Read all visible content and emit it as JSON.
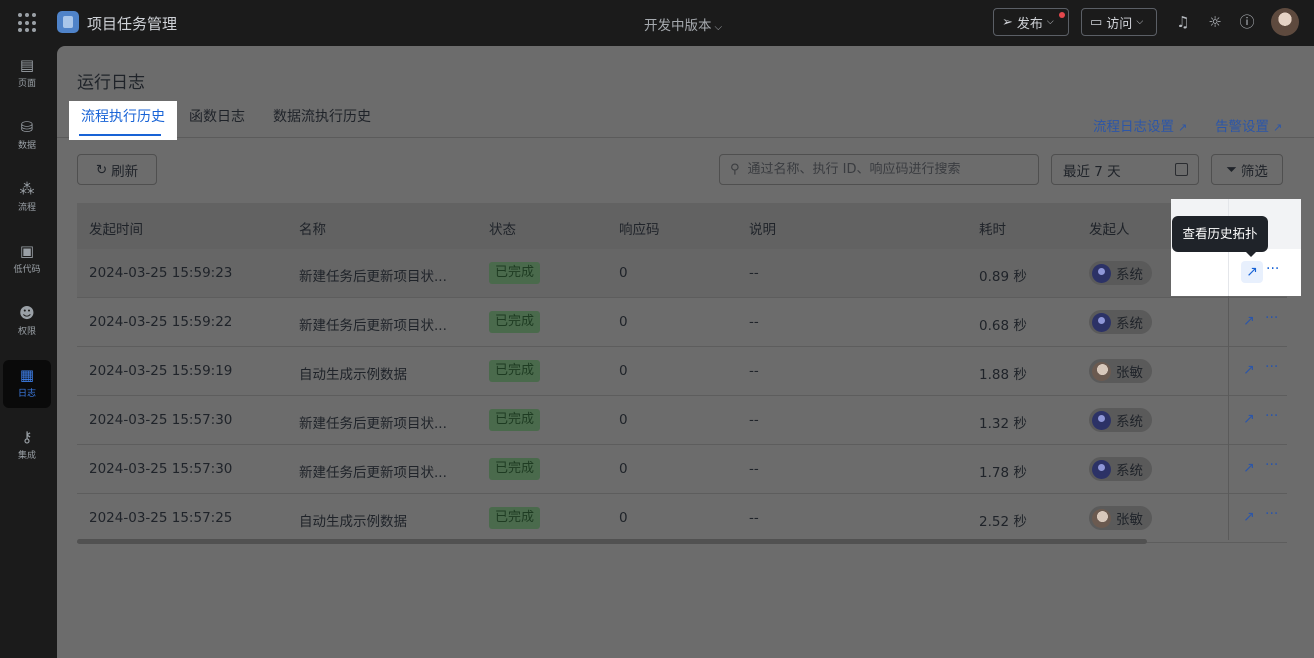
{
  "app": {
    "name": "项目任务管理",
    "version": "开发中版本"
  },
  "topbar": {
    "publish_label": "发布",
    "visit_label": "访问"
  },
  "sidebar": {
    "items": [
      {
        "label": "页面",
        "icon": "page-icon"
      },
      {
        "label": "数据",
        "icon": "database-icon"
      },
      {
        "label": "流程",
        "icon": "flow-icon"
      },
      {
        "label": "低代码",
        "icon": "code-icon"
      },
      {
        "label": "权限",
        "icon": "users-icon"
      },
      {
        "label": "日志",
        "icon": "log-icon",
        "active": true
      },
      {
        "label": "集成",
        "icon": "key-icon"
      }
    ]
  },
  "page": {
    "title": "运行日志",
    "tabs": [
      "流程执行历史",
      "函数日志",
      "数据流执行历史"
    ],
    "links": {
      "flow_log_settings": "流程日志设置",
      "alert_settings": "告警设置"
    }
  },
  "toolbar": {
    "refresh_label": "刷新",
    "search_placeholder": "通过名称、执行 ID、响应码进行搜索",
    "date_range": "最近 7 天",
    "filter_label": "筛选"
  },
  "table": {
    "columns": [
      "发起时间",
      "名称",
      "状态",
      "响应码",
      "说明",
      "耗时",
      "发起人"
    ],
    "rows": [
      {
        "time": "2024-03-25 15:59:23",
        "name": "新建任务后更新项目状...",
        "status": "已完成",
        "code": "0",
        "note": "--",
        "duration": "0.89 秒",
        "initiator": "系统",
        "avatar": "system"
      },
      {
        "time": "2024-03-25 15:59:22",
        "name": "新建任务后更新项目状...",
        "status": "已完成",
        "code": "0",
        "note": "--",
        "duration": "0.68 秒",
        "initiator": "系统",
        "avatar": "system"
      },
      {
        "time": "2024-03-25 15:59:19",
        "name": "自动生成示例数据",
        "status": "已完成",
        "code": "0",
        "note": "--",
        "duration": "1.88 秒",
        "initiator": "张敏",
        "avatar": "photo"
      },
      {
        "time": "2024-03-25 15:57:30",
        "name": "新建任务后更新项目状...",
        "status": "已完成",
        "code": "0",
        "note": "--",
        "duration": "1.32 秒",
        "initiator": "系统",
        "avatar": "system"
      },
      {
        "time": "2024-03-25 15:57:30",
        "name": "新建任务后更新项目状...",
        "status": "已完成",
        "code": "0",
        "note": "--",
        "duration": "1.78 秒",
        "initiator": "系统",
        "avatar": "system"
      },
      {
        "time": "2024-03-25 15:57:25",
        "name": "自动生成示例数据",
        "status": "已完成",
        "code": "0",
        "note": "--",
        "duration": "2.52 秒",
        "initiator": "张敏",
        "avatar": "photo"
      }
    ]
  },
  "tooltip": {
    "text": "查看历史拓扑"
  },
  "colors": {
    "accent": "#1863d6",
    "link": "#2c56a8",
    "success_bg": "#4a6a4c"
  }
}
